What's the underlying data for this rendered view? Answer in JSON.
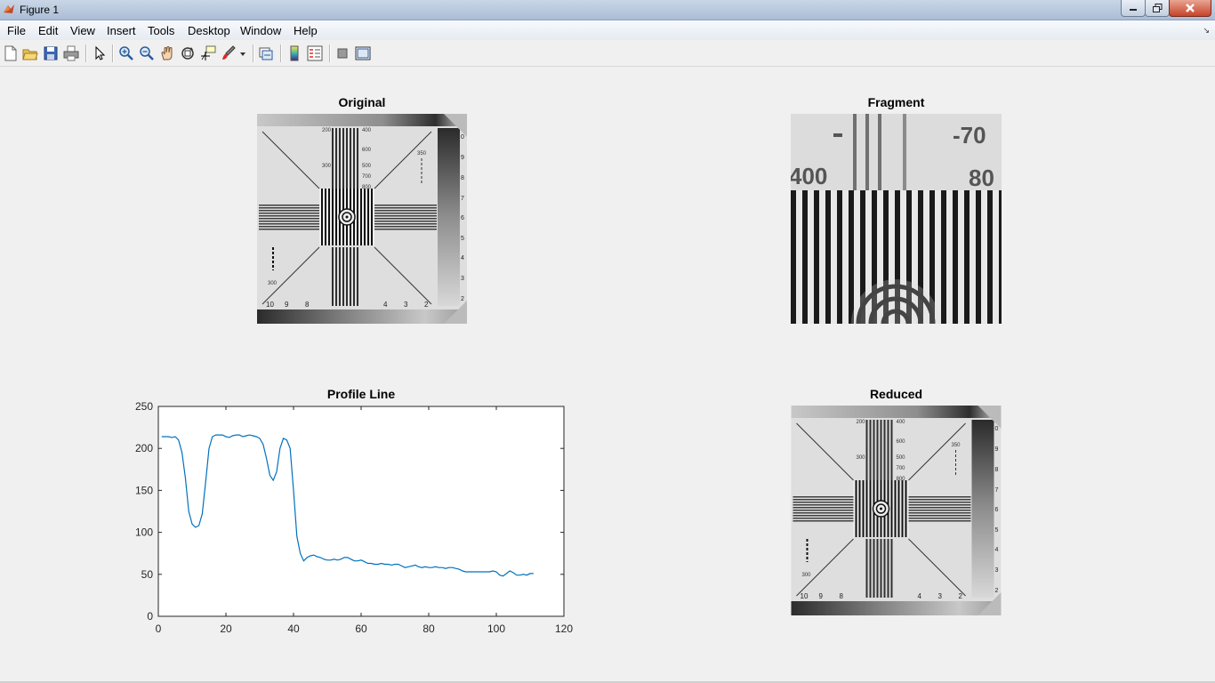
{
  "window": {
    "title": "Figure 1",
    "title_icon": "matlab-icon"
  },
  "menu": [
    "File",
    "Edit",
    "View",
    "Insert",
    "Tools",
    "Desktop",
    "Window",
    "Help"
  ],
  "toolbar": [
    "new-figure-icon",
    "open-file-icon",
    "save-icon",
    "print-icon",
    "select-arrow-icon",
    "zoom-in-icon",
    "zoom-out-icon",
    "pan-hand-icon",
    "rotate-3d-icon",
    "data-cursor-icon",
    "brush-icon",
    "link-plot-icon",
    "colorbar-icon",
    "legend-icon",
    "hide-plot-tools-icon",
    "show-plot-tools-icon"
  ],
  "axes": {
    "original": {
      "title": "Original"
    },
    "fragment": {
      "title": "Fragment"
    },
    "reduced": {
      "title": "Reduced"
    }
  },
  "image_labels": {
    "top_numbers": [
      "200",
      "400",
      "600",
      "500",
      "700",
      "800",
      "300",
      "350"
    ],
    "bottom_row": [
      "10",
      "9",
      "8",
      "4",
      "3",
      "2"
    ],
    "side_scale": [
      "0",
      "9",
      "8",
      "7",
      "6",
      "5",
      "4",
      "3",
      "2"
    ],
    "fragment_text": [
      "400",
      "-70",
      "80"
    ]
  },
  "chart_data": {
    "type": "line",
    "title": "Profile Line",
    "xlabel": "",
    "ylabel": "",
    "xlim": [
      0,
      120
    ],
    "ylim": [
      0,
      250
    ],
    "xticks": [
      0,
      20,
      40,
      60,
      80,
      100,
      120
    ],
    "yticks": [
      0,
      50,
      100,
      150,
      200,
      250
    ],
    "line_color": "#0072bd",
    "grid": false,
    "x": [
      1,
      2,
      3,
      4,
      5,
      6,
      7,
      8,
      9,
      10,
      11,
      12,
      13,
      14,
      15,
      16,
      17,
      18,
      19,
      20,
      21,
      22,
      23,
      24,
      25,
      26,
      27,
      28,
      29,
      30,
      31,
      32,
      33,
      34,
      35,
      36,
      37,
      38,
      39,
      40,
      41,
      42,
      43,
      44,
      45,
      46,
      47,
      48,
      49,
      50,
      51,
      52,
      53,
      54,
      55,
      56,
      57,
      58,
      59,
      60,
      61,
      62,
      63,
      64,
      65,
      66,
      67,
      68,
      69,
      70,
      71,
      72,
      73,
      74,
      75,
      76,
      77,
      78,
      79,
      80,
      81,
      82,
      83,
      84,
      85,
      86,
      87,
      88,
      89,
      90,
      91,
      92,
      93,
      94,
      95,
      96,
      97,
      98,
      99,
      100,
      101,
      102,
      103,
      104,
      105,
      106,
      107,
      108,
      109,
      110,
      111
    ],
    "y": [
      214,
      214,
      214,
      213,
      214,
      210,
      195,
      165,
      125,
      110,
      106,
      108,
      122,
      160,
      200,
      214,
      216,
      216,
      216,
      214,
      213,
      215,
      216,
      216,
      214,
      215,
      216,
      215,
      214,
      212,
      205,
      188,
      168,
      162,
      172,
      200,
      212,
      210,
      200,
      150,
      95,
      75,
      66,
      70,
      72,
      73,
      71,
      70,
      68,
      67,
      67,
      68,
      67,
      68,
      70,
      70,
      68,
      66,
      66,
      67,
      65,
      63,
      63,
      62,
      62,
      63,
      62,
      62,
      61,
      62,
      62,
      60,
      58,
      59,
      60,
      61,
      59,
      58,
      59,
      58,
      58,
      59,
      58,
      58,
      57,
      58,
      58,
      57,
      56,
      54,
      53,
      53,
      53,
      53,
      53,
      53,
      53,
      53,
      54,
      53,
      49,
      48,
      51,
      54,
      52,
      49,
      49,
      50,
      49,
      51,
      51
    ]
  }
}
